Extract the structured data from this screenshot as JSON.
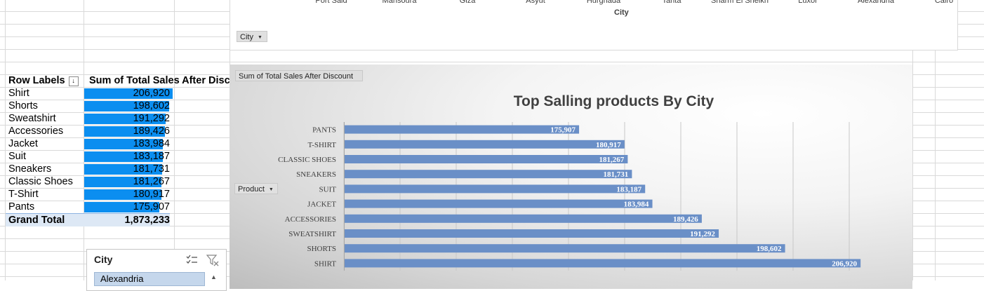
{
  "top_chart": {
    "cities": [
      "Port Said",
      "Mansoura",
      "Giza",
      "Asyut",
      "Hurghada",
      "Tanta",
      "Sharm El Sheikh",
      "Luxor",
      "Alexandria",
      "Cairo"
    ],
    "axis_title": "City",
    "field_button": "City"
  },
  "pivot": {
    "header_row_labels": "Row Labels",
    "header_values": "Sum of Total Sales After Disc",
    "rows": [
      {
        "label": "Shirt",
        "value": "206,920",
        "amount": 206920
      },
      {
        "label": "Shorts",
        "value": "198,602",
        "amount": 198602
      },
      {
        "label": "Sweatshirt",
        "value": "191,292",
        "amount": 191292
      },
      {
        "label": "Accessories",
        "value": "189,426",
        "amount": 189426
      },
      {
        "label": "Jacket",
        "value": "183,984",
        "amount": 183984
      },
      {
        "label": "Suit",
        "value": "183,187",
        "amount": 183187
      },
      {
        "label": "Sneakers",
        "value": "181,731",
        "amount": 181731
      },
      {
        "label": "Classic Shoes",
        "value": "181,267",
        "amount": 181267
      },
      {
        "label": "T-Shirt",
        "value": "180,917",
        "amount": 180917
      },
      {
        "label": "Pants",
        "value": "175,907",
        "amount": 175907
      }
    ],
    "grand_total_label": "Grand Total",
    "grand_total_value": "1,873,233"
  },
  "slicer": {
    "title": "City",
    "first_item": "Alexandria"
  },
  "chart_data": {
    "type": "bar",
    "orientation": "horizontal",
    "title": "Top Salling products By City",
    "field_button_values": "Sum of Total Sales After Discount",
    "field_button_axis": "Product",
    "categories": [
      "PANTS",
      "T-SHIRT",
      "CLASSIC SHOES",
      "SNEAKERS",
      "SUIT",
      "JACKET",
      "ACCESSORIES",
      "SWEATSHIRT",
      "SHORTS",
      "SHIRT"
    ],
    "values": [
      175907,
      180917,
      181267,
      181731,
      183187,
      183984,
      189426,
      191292,
      198602,
      206920
    ],
    "value_labels": [
      "175,907",
      "180,917",
      "181,267",
      "181,731",
      "183,187",
      "183,984",
      "189,426",
      "191,292",
      "198,602",
      "206,920"
    ],
    "xlim": [
      150000,
      210000
    ],
    "grid": true,
    "bar_color": "#6a8fc7"
  }
}
